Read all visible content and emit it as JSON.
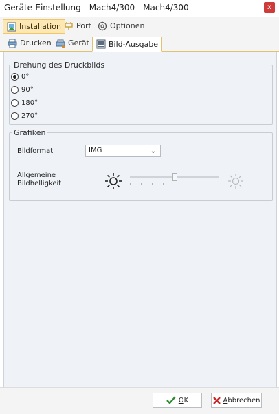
{
  "window": {
    "title": "Geräte-Einstellung -  Mach4/300  - Mach4/300",
    "close_label": "x"
  },
  "main_tabs": [
    {
      "label": "Installation",
      "icon": "installation-icon",
      "active": true
    },
    {
      "label": "Port",
      "icon": "port-icon",
      "active": false
    },
    {
      "label": "Optionen",
      "icon": "options-icon",
      "active": false
    }
  ],
  "sub_tabs": [
    {
      "label": "Drucken",
      "icon": "printer-icon",
      "active": false
    },
    {
      "label": "Gerät",
      "icon": "device-icon",
      "active": false
    },
    {
      "label": "Bild-Ausgabe",
      "icon": "image-output-icon",
      "active": true
    }
  ],
  "rotation": {
    "legend": "Drehung des Druckbilds",
    "options": [
      "0°",
      "90°",
      "180°",
      "270°"
    ],
    "selected": "0°"
  },
  "graphics": {
    "legend": "Grafiken",
    "format_label": "Bildformat",
    "format_value": "IMG",
    "brightness_label_line1": "Allgemeine",
    "brightness_label_line2": "Bildhelligkeit",
    "brightness_level": 0.5
  },
  "footer": {
    "ok": {
      "prefix": "",
      "accel": "O",
      "rest": "K"
    },
    "cancel": {
      "prefix": "",
      "accel": "A",
      "rest": "bbrechen"
    }
  },
  "colors": {
    "active_tab": "#fde7b3",
    "panel_bg": "#eff2f6",
    "ok_icon": "#2e8b2e",
    "cancel_icon": "#c62828"
  }
}
